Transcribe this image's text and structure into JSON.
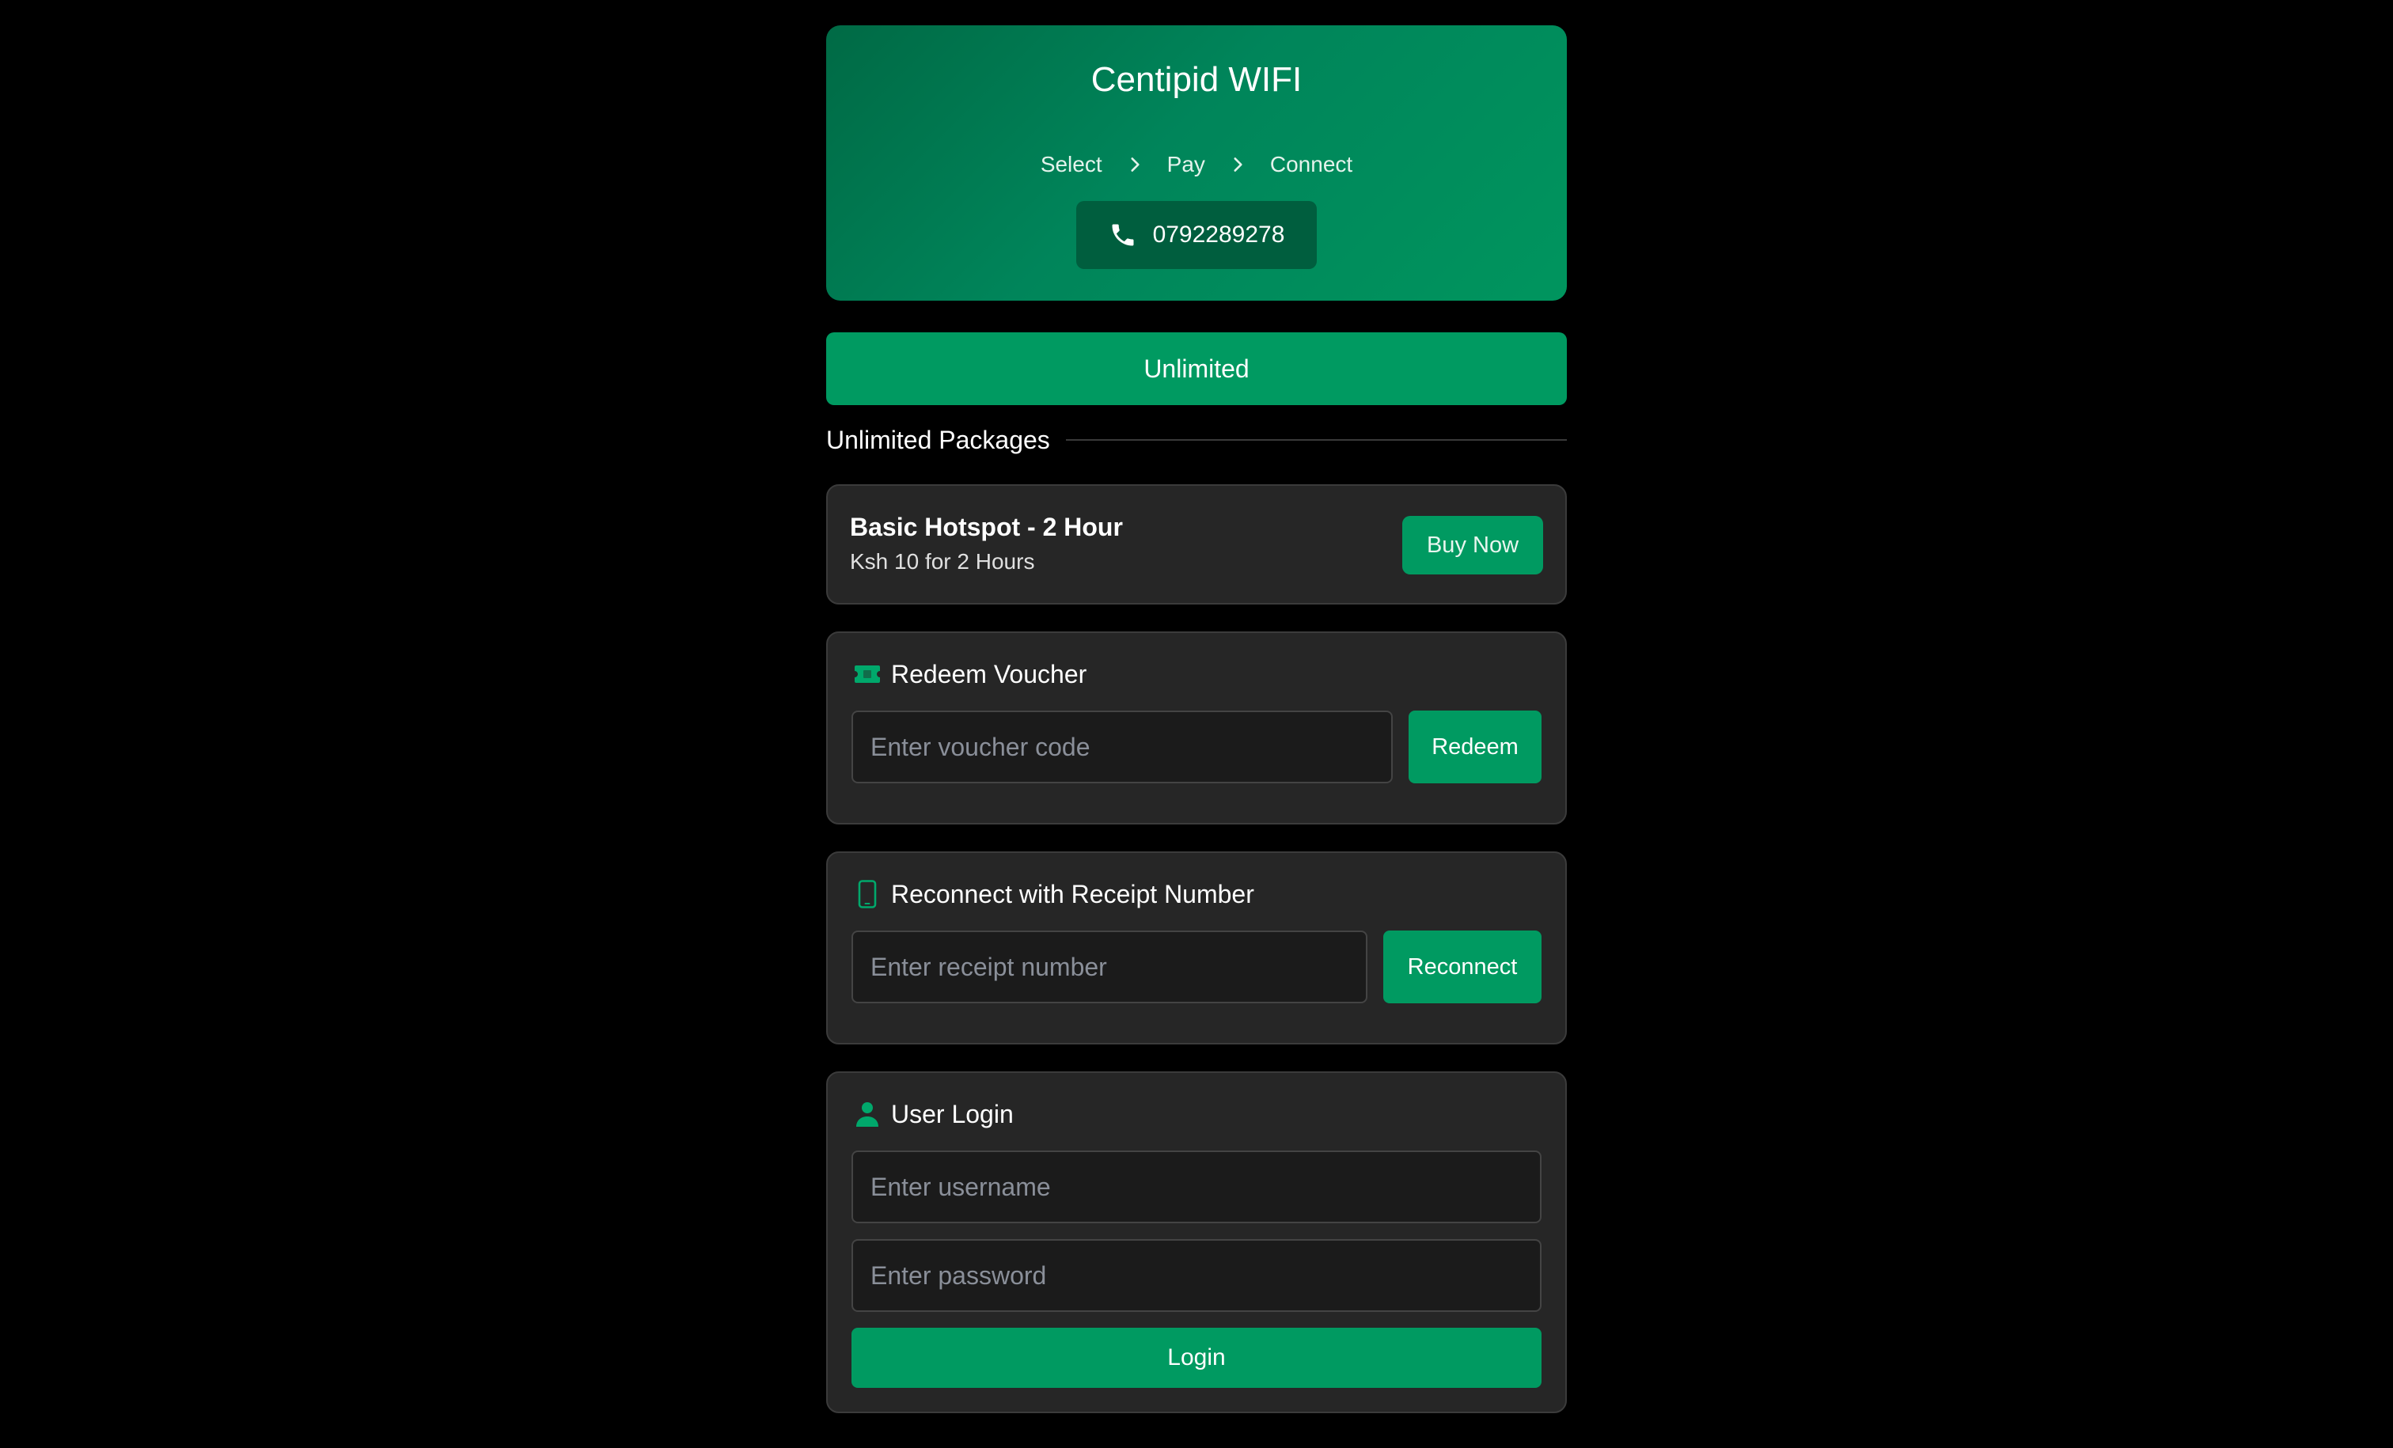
{
  "header": {
    "title": "Centipid WIFI",
    "steps": [
      "Select",
      "Pay",
      "Connect"
    ],
    "phone": "0792289278"
  },
  "tab": {
    "label": "Unlimited"
  },
  "packages": {
    "heading": "Unlimited Packages",
    "items": [
      {
        "name": "Basic Hotspot - 2 Hour",
        "description": "Ksh 10 for 2 Hours",
        "button": "Buy Now"
      }
    ]
  },
  "voucher": {
    "title": "Redeem Voucher",
    "placeholder": "Enter voucher code",
    "button": "Redeem",
    "icon": "ticket-icon"
  },
  "receipt": {
    "title": "Reconnect with Receipt Number",
    "placeholder": "Enter receipt number",
    "button": "Reconnect",
    "icon": "mobile-phone-icon"
  },
  "login": {
    "title": "User Login",
    "username_placeholder": "Enter username",
    "password_placeholder": "Enter password",
    "button": "Login",
    "icon": "user-icon"
  },
  "colors": {
    "background": "#000000",
    "accent": "#009a61",
    "card": "#262626"
  }
}
